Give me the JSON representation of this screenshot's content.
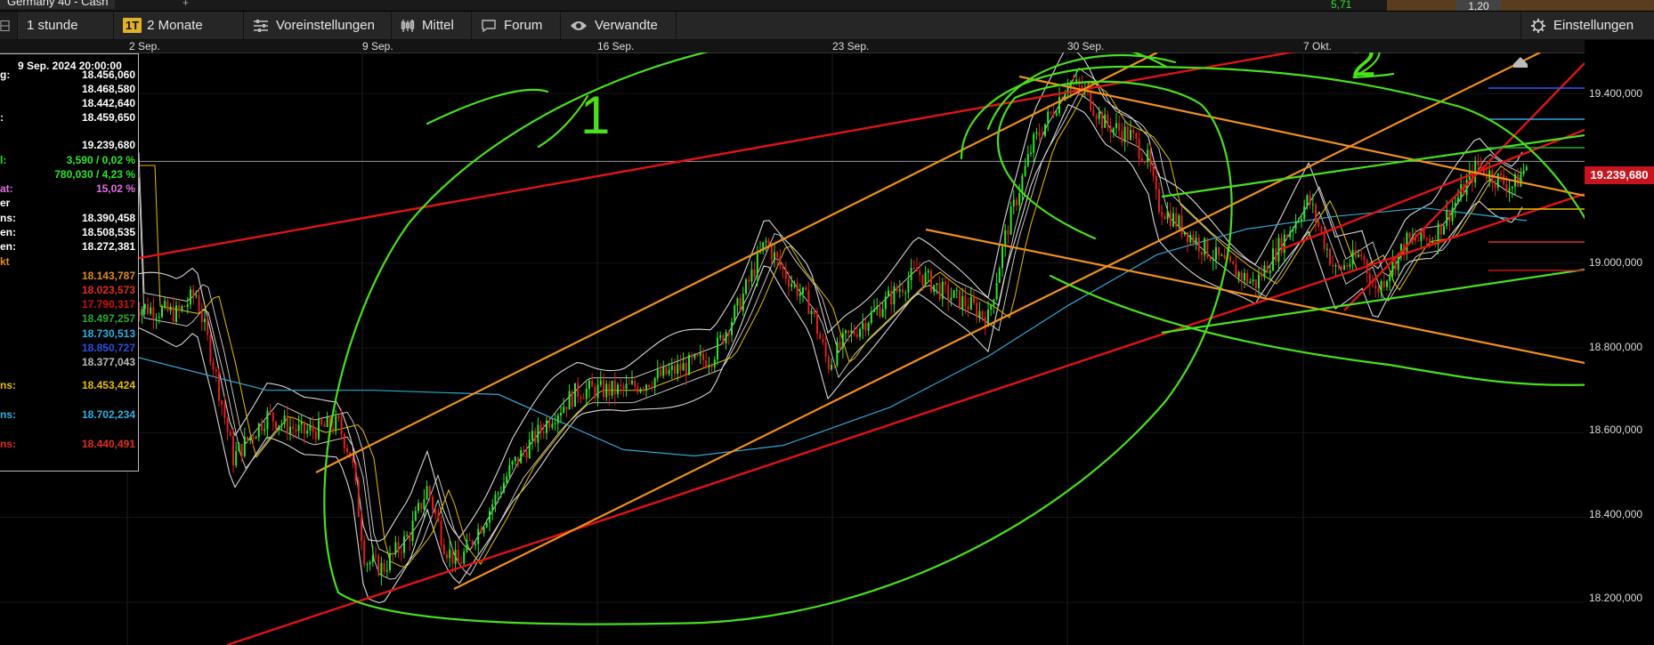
{
  "window": {
    "tab_title": "Germany 40 - Cash",
    "value_1": "5,71",
    "value_2": "1,20"
  },
  "toolbar": {
    "interval": "1 stunde",
    "range_badge": "1T",
    "range": "2 Monate",
    "presets": "Voreinstellungen",
    "average": "Mittel",
    "forum": "Forum",
    "related": "Verwandte",
    "settings": "Einstellungen"
  },
  "date_axis": [
    "2 Sep.",
    "9 Sep.",
    "16 Sep.",
    "23 Sep.",
    "30 Sep.",
    "7 Okt."
  ],
  "price_axis": [
    "19.400,000",
    "19.239,680",
    "19.000,000",
    "18.800,000",
    "18.600,000",
    "18.400,000",
    "18.200,000"
  ],
  "current_price": "19.239,680",
  "annotations": {
    "wave_1": "1",
    "wave_2": "2"
  },
  "info_panel": {
    "date": "9 Sep. 2024 20:00:00",
    "rows": [
      {
        "key": "g:",
        "value": "18.456,060",
        "color": "#ffffff"
      },
      {
        "key": "",
        "value": "18.468,580",
        "color": "#ffffff"
      },
      {
        "key": "",
        "value": "18.442,640",
        "color": "#ffffff"
      },
      {
        "key": ":",
        "value": "18.459,650",
        "color": "#ffffff"
      },
      {
        "key": "",
        "value": "19.239,680",
        "color": "#ffffff"
      },
      {
        "key": "l:",
        "value": "3,590 / 0,02 %",
        "color": "#2ee62e"
      },
      {
        "key": "",
        "value": "780,030 / 4,23 %",
        "color": "#2ee62e"
      },
      {
        "key": "at:",
        "value": "15,02 %",
        "color": "#e070e0"
      },
      {
        "key": "er",
        "value": "",
        "color": "#ffffff"
      },
      {
        "key": "ns:",
        "value": "18.390,458",
        "color": "#ffffff"
      },
      {
        "key": "en:",
        "value": "18.508,535",
        "color": "#ffffff"
      },
      {
        "key": "en:",
        "value": "18.272,381",
        "color": "#ffffff"
      },
      {
        "key": "kt",
        "value": "",
        "color": "#e08b1c"
      },
      {
        "key": "",
        "value": "18.143,787",
        "color": "#e08b1c"
      },
      {
        "key": "",
        "value": "18.023,573",
        "color": "#e03020"
      },
      {
        "key": "",
        "value": "17.790,317",
        "color": "#d01010"
      },
      {
        "key": "",
        "value": "18.497,257",
        "color": "#2ea82e"
      },
      {
        "key": "",
        "value": "18.730,513",
        "color": "#30b0e0"
      },
      {
        "key": "",
        "value": "18.850,727",
        "color": "#3050e0"
      },
      {
        "key": "",
        "value": "18.377,043",
        "color": "#bbbbbb"
      },
      {
        "key": "ns:",
        "value": "18.453,424",
        "color": "#e6c000"
      },
      {
        "key": "ns:",
        "value": "18.702,234",
        "color": "#30b0e0"
      },
      {
        "key": "ns:",
        "value": "18.440,491",
        "color": "#e03020"
      }
    ]
  },
  "colors": {
    "up": "#2ee62e",
    "down": "#e02020",
    "orange": "#f0901c",
    "red": "#e01414",
    "green": "#49e01c",
    "bollinger": "#d8d8d8",
    "sma": "#e6c000",
    "long_ma": "#30a8d8"
  },
  "icons": [
    "grid-icon",
    "sliders-icon",
    "candles-icon",
    "chat-icon",
    "eye-icon",
    "gear-icon"
  ]
}
